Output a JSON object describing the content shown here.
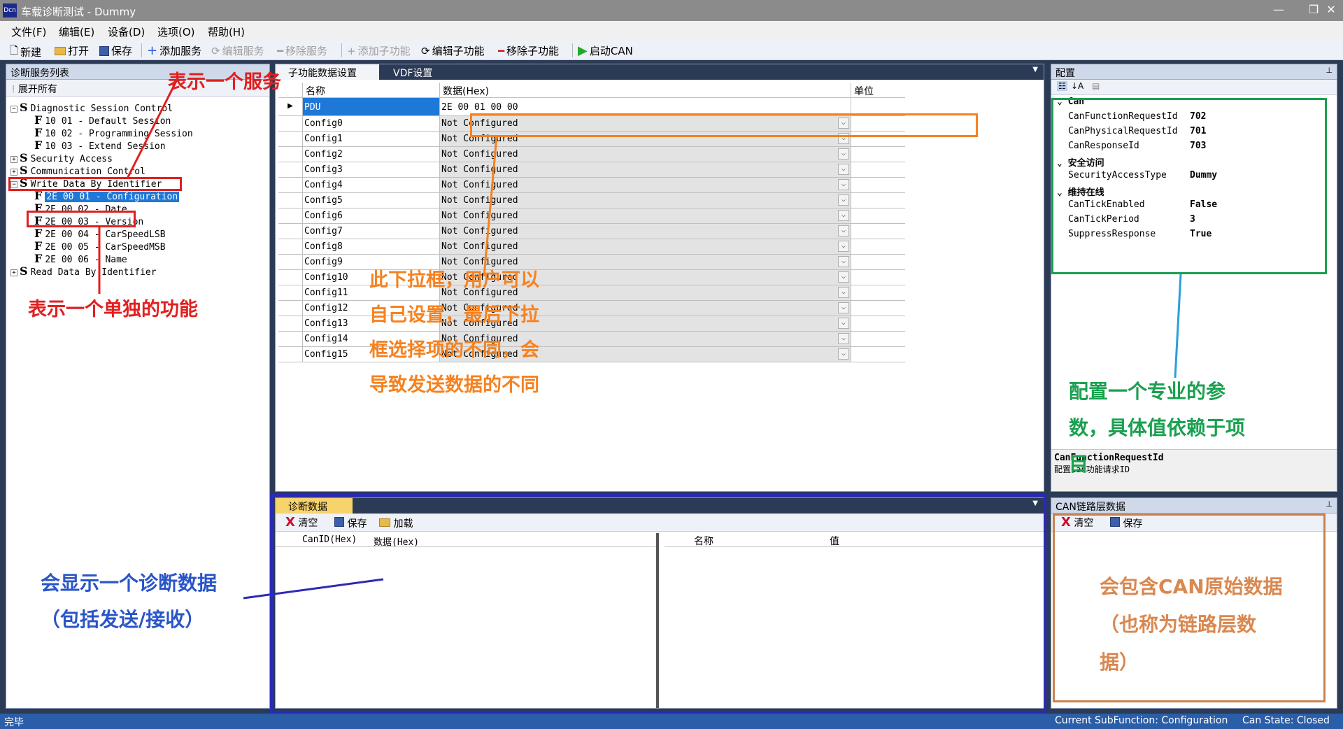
{
  "window": {
    "title": "车载诊断测试 - Dummy",
    "app_icon": "Dcn",
    "min": "—",
    "max": "❐",
    "close": "✕"
  },
  "menu": [
    "文件(F)",
    "编辑(E)",
    "设备(D)",
    "选项(O)",
    "帮助(H)"
  ],
  "toolbar": {
    "new": "新建",
    "open": "打开",
    "save": "保存",
    "add_service": "添加服务",
    "edit_service": "编辑服务",
    "remove_service": "移除服务",
    "add_sub": "添加子功能",
    "edit_sub": "编辑子功能",
    "remove_sub": "移除子功能",
    "start_can": "启动CAN"
  },
  "left_panel": {
    "title": "诊断服务列表",
    "expand_all": "展开所有",
    "pin": "ᚚ"
  },
  "tree": [
    {
      "label": "Diagnostic Session Control",
      "kind": "S",
      "expander": "−"
    },
    {
      "label": "10 01 - Default Session",
      "kind": "F"
    },
    {
      "label": "10 02 - Programming Session",
      "kind": "F"
    },
    {
      "label": "10 03 - Extend Session",
      "kind": "F"
    },
    {
      "label": "Security Access",
      "kind": "S",
      "expander": "+"
    },
    {
      "label": "Communication Control",
      "kind": "S",
      "expander": "+"
    },
    {
      "label": "Write Data By Identifier",
      "kind": "S",
      "expander": "−"
    },
    {
      "label": "2E 00 01 - Configuration",
      "kind": "F",
      "selected": true
    },
    {
      "label": "2E 00 02 - Date",
      "kind": "F"
    },
    {
      "label": "2E 00 03 - Version",
      "kind": "F"
    },
    {
      "label": "2E 00 04 - CarSpeedLSB",
      "kind": "F"
    },
    {
      "label": "2E 00 05 - CarSpeedMSB",
      "kind": "F"
    },
    {
      "label": "2E 00 06 - Name",
      "kind": "F"
    },
    {
      "label": "Read Data By Identifier",
      "kind": "S",
      "expander": "+"
    }
  ],
  "center": {
    "tabs": [
      "子功能数据设置",
      "VDF设置"
    ],
    "columns": [
      "名称",
      "数据(Hex)",
      "单位"
    ],
    "pdu": {
      "name": "PDU",
      "value": "2E 00 01 00 00"
    },
    "rows": [
      {
        "name": "Config0",
        "value": "Not Configured"
      },
      {
        "name": "Config1",
        "value": "Not Configured"
      },
      {
        "name": "Config2",
        "value": "Not Configured"
      },
      {
        "name": "Config3",
        "value": "Not Configured"
      },
      {
        "name": "Config4",
        "value": "Not Configured"
      },
      {
        "name": "Config5",
        "value": "Not Configured"
      },
      {
        "name": "Config6",
        "value": "Not Configured"
      },
      {
        "name": "Config7",
        "value": "Not Configured"
      },
      {
        "name": "Config8",
        "value": "Not Configured"
      },
      {
        "name": "Config9",
        "value": "Not Configured"
      },
      {
        "name": "Config10",
        "value": "Not Configured"
      },
      {
        "name": "Config11",
        "value": "Not Configured"
      },
      {
        "name": "Config12",
        "value": "Not Configured"
      },
      {
        "name": "Config13",
        "value": "Not Configured"
      },
      {
        "name": "Config14",
        "value": "Not Configured"
      },
      {
        "name": "Config15",
        "value": "Not Configured"
      }
    ]
  },
  "config_panel": {
    "title": "配置",
    "groups": [
      {
        "name": "Can",
        "props": [
          {
            "k": "CanFunctionRequestId",
            "v": "702"
          },
          {
            "k": "CanPhysicalRequestId",
            "v": "701"
          },
          {
            "k": "CanResponseId",
            "v": "703"
          }
        ]
      },
      {
        "name": "安全访问",
        "props": [
          {
            "k": "SecurityAccessType",
            "v": "Dummy"
          }
        ]
      },
      {
        "name": "维持在线",
        "props": [
          {
            "k": "CanTickEnabled",
            "v": "False"
          },
          {
            "k": "CanTickPeriod",
            "v": "3"
          },
          {
            "k": "SuppressResponse",
            "v": "True"
          }
        ]
      }
    ],
    "desc_title": "CanFunctionRequestId",
    "desc_text": "配置Can功能请求ID"
  },
  "diag_panel": {
    "title": "诊断数据",
    "clear": "清空",
    "save": "保存",
    "load": "加载",
    "cols_left": [
      "CanID(Hex)",
      "数据(Hex)"
    ],
    "cols_right": [
      "名称",
      "值"
    ]
  },
  "can_panel": {
    "title": "CAN链路层数据",
    "clear": "清空",
    "save": "保存"
  },
  "status": {
    "left": "完毕",
    "subfunction": "Current SubFunction: Configuration",
    "can_state": "Can State: Closed"
  },
  "annotations": {
    "service": "表示一个服务",
    "function": "表示一个单独的功能",
    "dropdown": [
      "此下拉框，用户可以",
      "自己设置，最后下拉",
      "框选择项的不同，会",
      "导致发送数据的不同"
    ],
    "config": [
      "配置一个专业的参",
      "数，具体值依赖于项",
      "目"
    ],
    "diag": [
      "会显示一个诊断数据",
      "（包括发送/接收）"
    ],
    "can": [
      "会包含CAN原始数据",
      "（也称为链路层数",
      "据）"
    ]
  },
  "colors": {
    "accent": "#2b5ea8",
    "selection": "#1e78d7",
    "red": "#e02020",
    "orange": "#f58220",
    "green": "#1aa050",
    "blue": "#2a2ab8",
    "brown": "#c8834f"
  }
}
